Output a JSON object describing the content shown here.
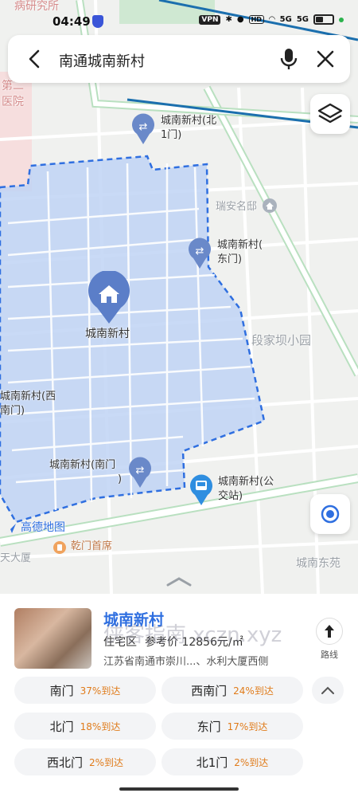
{
  "status": {
    "time": "04:49",
    "vpn": "VPN",
    "hd": "HD",
    "net_a": "5G",
    "net_b": "5G"
  },
  "search": {
    "query": "南通城南新村",
    "back_icon": "chevron-left-icon",
    "mic_icon": "microphone-icon",
    "close_icon": "close-icon"
  },
  "map": {
    "area_fill": "#bfd3f5",
    "boundary_color": "#2f6fe0",
    "labels": {
      "top_left_poi": "病研究所",
      "hospital_a": "第二",
      "hospital_b": "医院",
      "gate_north": "城南新村(北1门)",
      "gate_north_l1": "城南新村(北",
      "gate_north_l2": "1门)",
      "ruian": "瑞安名邸",
      "gate_east_l1": "城南新村(",
      "gate_east_l2": "东门)",
      "main_poi": "城南新村",
      "duanjiaba": "段家坝小园",
      "gate_west_l1": "城南新村(西",
      "gate_west_l2": "南门)",
      "gate_south_l1": "城南新村(南门",
      "gate_south_l2": ")",
      "bus_l1": "城南新村(公",
      "bus_l2": "交站)",
      "amap": "高德地图",
      "qianmen": "乾门首席",
      "dasha": "天大厦",
      "chengnan_east": "城南东苑"
    }
  },
  "poi": {
    "name": "城南新村",
    "category": "住宅区",
    "price": "参考价 12856元/㎡",
    "address": "江苏省南通市崇川...、水利大厦西侧",
    "route_label": "路线"
  },
  "gates": [
    {
      "name": "南门",
      "pct": "37%到达"
    },
    {
      "name": "西南门",
      "pct": "24%到达"
    },
    {
      "name": "北门",
      "pct": "18%到达"
    },
    {
      "name": "东门",
      "pct": "17%到达"
    },
    {
      "name": "西北门",
      "pct": "2%到达"
    },
    {
      "name": "北1门",
      "pct": "2%到达"
    }
  ],
  "watermark": "侠客指南 xczn.xyz"
}
